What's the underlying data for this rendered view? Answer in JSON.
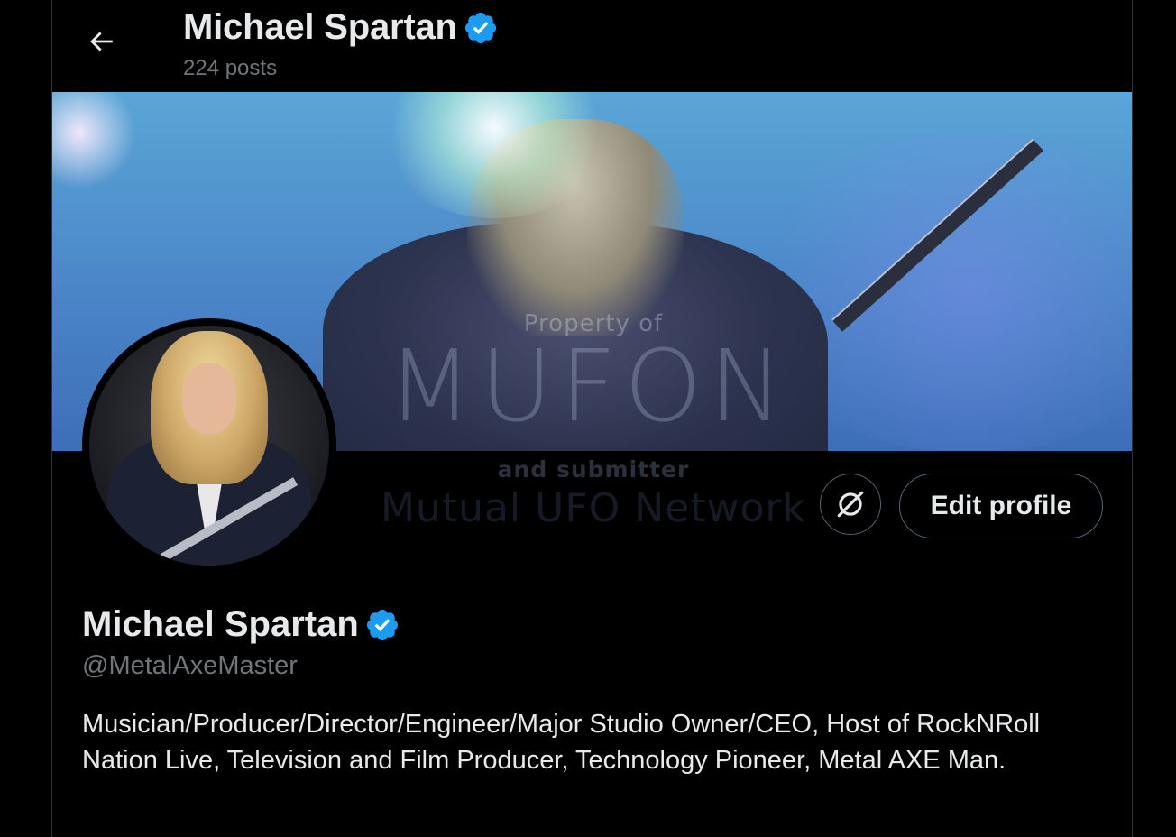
{
  "header": {
    "name": "Michael Spartan",
    "posts_count": "224 posts"
  },
  "banner": {
    "watermark_line1": "Property of",
    "watermark_logo": "MUFON",
    "watermark_line2": "and submitter",
    "watermark_line3": "Mutual UFO Network"
  },
  "actions": {
    "edit_profile_label": "Edit profile"
  },
  "profile": {
    "display_name": "Michael Spartan",
    "handle": "@MetalAxeMaster",
    "bio": "Musician/Producer/Director/Engineer/Major Studio Owner/CEO, Host of RockNRoll Nation Live, Television and Film Producer, Technology Pioneer, Metal AXE Man."
  },
  "colors": {
    "background": "#000000",
    "text_primary": "#e7e9ea",
    "text_secondary": "#71767b",
    "verified": "#1d9bf0",
    "border": "#536471"
  },
  "icons": {
    "back": "arrow-left-icon",
    "verified": "verified-badge-icon",
    "subscription_toggle": "no-sync-icon"
  }
}
